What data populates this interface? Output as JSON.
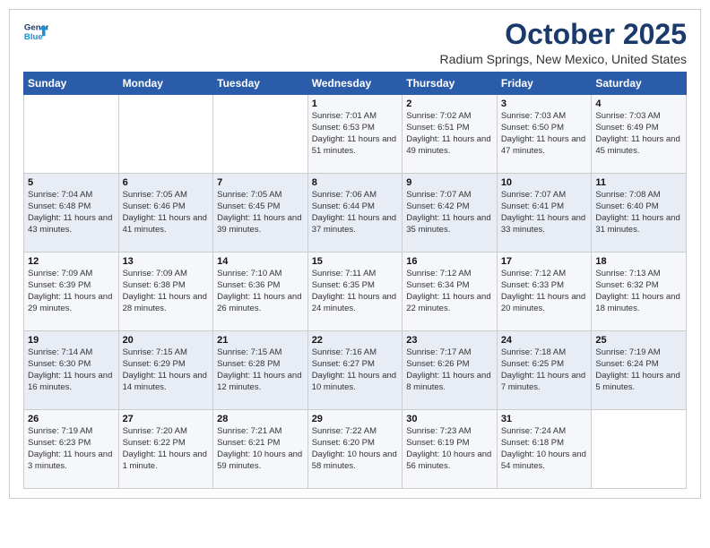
{
  "logo": {
    "line1": "General",
    "line2": "Blue"
  },
  "header": {
    "month": "October 2025",
    "location": "Radium Springs, New Mexico, United States"
  },
  "days_of_week": [
    "Sunday",
    "Monday",
    "Tuesday",
    "Wednesday",
    "Thursday",
    "Friday",
    "Saturday"
  ],
  "weeks": [
    [
      {
        "day": "",
        "info": ""
      },
      {
        "day": "",
        "info": ""
      },
      {
        "day": "",
        "info": ""
      },
      {
        "day": "1",
        "info": "Sunrise: 7:01 AM\nSunset: 6:53 PM\nDaylight: 11 hours\nand 51 minutes."
      },
      {
        "day": "2",
        "info": "Sunrise: 7:02 AM\nSunset: 6:51 PM\nDaylight: 11 hours\nand 49 minutes."
      },
      {
        "day": "3",
        "info": "Sunrise: 7:03 AM\nSunset: 6:50 PM\nDaylight: 11 hours\nand 47 minutes."
      },
      {
        "day": "4",
        "info": "Sunrise: 7:03 AM\nSunset: 6:49 PM\nDaylight: 11 hours\nand 45 minutes."
      }
    ],
    [
      {
        "day": "5",
        "info": "Sunrise: 7:04 AM\nSunset: 6:48 PM\nDaylight: 11 hours\nand 43 minutes."
      },
      {
        "day": "6",
        "info": "Sunrise: 7:05 AM\nSunset: 6:46 PM\nDaylight: 11 hours\nand 41 minutes."
      },
      {
        "day": "7",
        "info": "Sunrise: 7:05 AM\nSunset: 6:45 PM\nDaylight: 11 hours\nand 39 minutes."
      },
      {
        "day": "8",
        "info": "Sunrise: 7:06 AM\nSunset: 6:44 PM\nDaylight: 11 hours\nand 37 minutes."
      },
      {
        "day": "9",
        "info": "Sunrise: 7:07 AM\nSunset: 6:42 PM\nDaylight: 11 hours\nand 35 minutes."
      },
      {
        "day": "10",
        "info": "Sunrise: 7:07 AM\nSunset: 6:41 PM\nDaylight: 11 hours\nand 33 minutes."
      },
      {
        "day": "11",
        "info": "Sunrise: 7:08 AM\nSunset: 6:40 PM\nDaylight: 11 hours\nand 31 minutes."
      }
    ],
    [
      {
        "day": "12",
        "info": "Sunrise: 7:09 AM\nSunset: 6:39 PM\nDaylight: 11 hours\nand 29 minutes."
      },
      {
        "day": "13",
        "info": "Sunrise: 7:09 AM\nSunset: 6:38 PM\nDaylight: 11 hours\nand 28 minutes."
      },
      {
        "day": "14",
        "info": "Sunrise: 7:10 AM\nSunset: 6:36 PM\nDaylight: 11 hours\nand 26 minutes."
      },
      {
        "day": "15",
        "info": "Sunrise: 7:11 AM\nSunset: 6:35 PM\nDaylight: 11 hours\nand 24 minutes."
      },
      {
        "day": "16",
        "info": "Sunrise: 7:12 AM\nSunset: 6:34 PM\nDaylight: 11 hours\nand 22 minutes."
      },
      {
        "day": "17",
        "info": "Sunrise: 7:12 AM\nSunset: 6:33 PM\nDaylight: 11 hours\nand 20 minutes."
      },
      {
        "day": "18",
        "info": "Sunrise: 7:13 AM\nSunset: 6:32 PM\nDaylight: 11 hours\nand 18 minutes."
      }
    ],
    [
      {
        "day": "19",
        "info": "Sunrise: 7:14 AM\nSunset: 6:30 PM\nDaylight: 11 hours\nand 16 minutes."
      },
      {
        "day": "20",
        "info": "Sunrise: 7:15 AM\nSunset: 6:29 PM\nDaylight: 11 hours\nand 14 minutes."
      },
      {
        "day": "21",
        "info": "Sunrise: 7:15 AM\nSunset: 6:28 PM\nDaylight: 11 hours\nand 12 minutes."
      },
      {
        "day": "22",
        "info": "Sunrise: 7:16 AM\nSunset: 6:27 PM\nDaylight: 11 hours\nand 10 minutes."
      },
      {
        "day": "23",
        "info": "Sunrise: 7:17 AM\nSunset: 6:26 PM\nDaylight: 11 hours\nand 8 minutes."
      },
      {
        "day": "24",
        "info": "Sunrise: 7:18 AM\nSunset: 6:25 PM\nDaylight: 11 hours\nand 7 minutes."
      },
      {
        "day": "25",
        "info": "Sunrise: 7:19 AM\nSunset: 6:24 PM\nDaylight: 11 hours\nand 5 minutes."
      }
    ],
    [
      {
        "day": "26",
        "info": "Sunrise: 7:19 AM\nSunset: 6:23 PM\nDaylight: 11 hours\nand 3 minutes."
      },
      {
        "day": "27",
        "info": "Sunrise: 7:20 AM\nSunset: 6:22 PM\nDaylight: 11 hours\nand 1 minute."
      },
      {
        "day": "28",
        "info": "Sunrise: 7:21 AM\nSunset: 6:21 PM\nDaylight: 10 hours\nand 59 minutes."
      },
      {
        "day": "29",
        "info": "Sunrise: 7:22 AM\nSunset: 6:20 PM\nDaylight: 10 hours\nand 58 minutes."
      },
      {
        "day": "30",
        "info": "Sunrise: 7:23 AM\nSunset: 6:19 PM\nDaylight: 10 hours\nand 56 minutes."
      },
      {
        "day": "31",
        "info": "Sunrise: 7:24 AM\nSunset: 6:18 PM\nDaylight: 10 hours\nand 54 minutes."
      },
      {
        "day": "",
        "info": ""
      }
    ]
  ]
}
